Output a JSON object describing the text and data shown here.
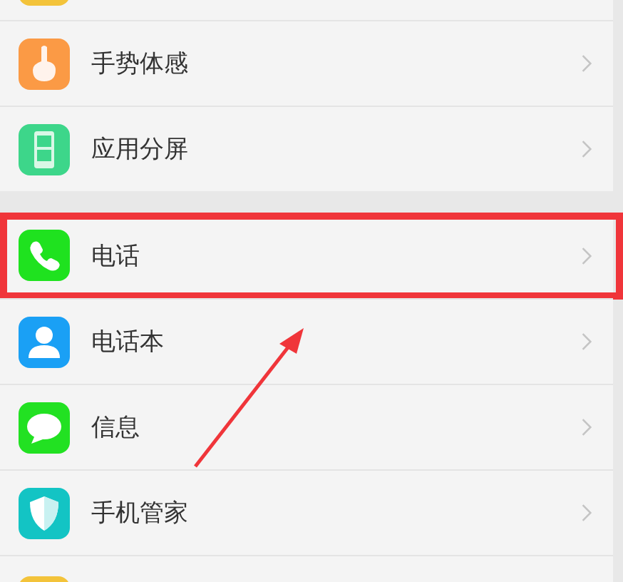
{
  "groups": [
    {
      "items": [
        {
          "kind": "partial-top",
          "highlighted": false
        },
        {
          "kind": "gesture",
          "label": "手势体感",
          "highlighted": false
        },
        {
          "kind": "split",
          "label": "应用分屏",
          "highlighted": false
        }
      ]
    },
    {
      "items": [
        {
          "kind": "phone",
          "label": "电话",
          "highlighted": true
        },
        {
          "kind": "contacts",
          "label": "电话本",
          "highlighted": false
        },
        {
          "kind": "message",
          "label": "信息",
          "highlighted": false
        },
        {
          "kind": "shield",
          "label": "手机管家",
          "highlighted": false
        },
        {
          "kind": "partial-bottom",
          "highlighted": false
        }
      ]
    }
  ],
  "annotation": {
    "arrow": true
  }
}
